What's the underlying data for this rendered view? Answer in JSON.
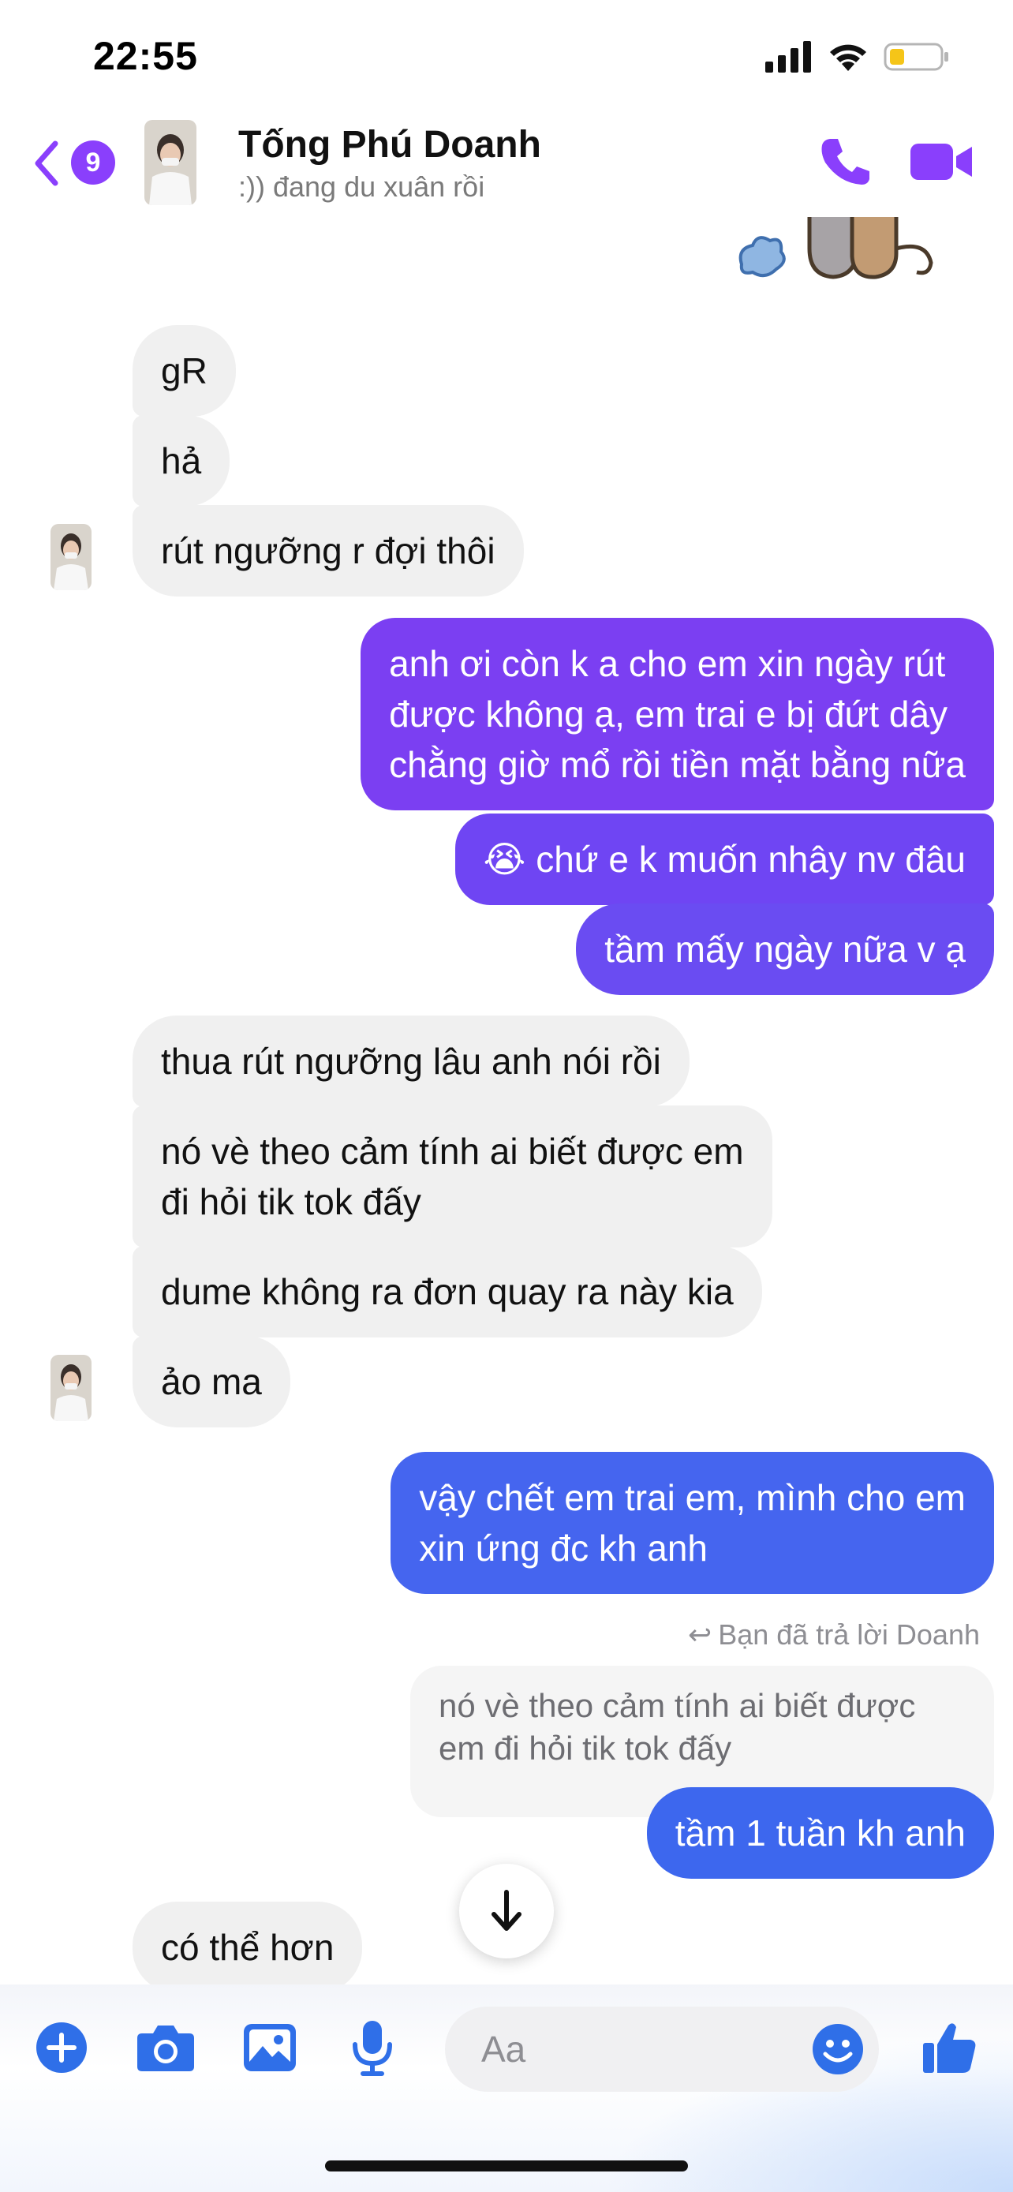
{
  "status_bar": {
    "time": "22:55"
  },
  "header": {
    "back_badge": "9",
    "name": "Tống Phú Doanh",
    "status": ":)) đang du xuân rồi"
  },
  "messages": [
    {
      "dir": "in",
      "text": "gR"
    },
    {
      "dir": "in",
      "text": "hả"
    },
    {
      "dir": "in",
      "text": "rút ngưỡng r đợi thôi"
    },
    {
      "dir": "out",
      "text": "anh ơi còn k a cho em xin ngày rút\nđược không ạ, em trai e bị đứt dây\nchằng giờ mổ rồi tiền mặt bằng nữa"
    },
    {
      "dir": "out",
      "text": "😭 chứ e k muốn nhây nv đâu"
    },
    {
      "dir": "out",
      "text": "tầm mấy ngày nữa v ạ"
    },
    {
      "dir": "in",
      "text": "thua rút ngưỡng lâu anh nói rồi"
    },
    {
      "dir": "in",
      "text": "nó vè theo cảm tính ai biết được em\nđi hỏi tik tok đấy"
    },
    {
      "dir": "in",
      "text": "dume không ra đơn quay ra này kia"
    },
    {
      "dir": "in",
      "text": "ảo ma"
    },
    {
      "dir": "out",
      "text": "vậy chết em trai em, mình cho em\nxin ứng đc kh anh"
    },
    {
      "dir": "out",
      "text": "tầm 1 tuần kh anh"
    },
    {
      "dir": "in",
      "text": "có thể hơn"
    }
  ],
  "reply": {
    "hint": "Bạn đã trả lời Doanh",
    "quote": "nó vè theo cảm tính ai biết được\nem đi hỏi tik tok đấy"
  },
  "composer": {
    "placeholder": "Aa"
  },
  "colors": {
    "accent": "#8a3ffc",
    "out_purple": "#7b3ff2",
    "out_blue": "#3d67ee",
    "incoming": "#f0f0f0"
  }
}
